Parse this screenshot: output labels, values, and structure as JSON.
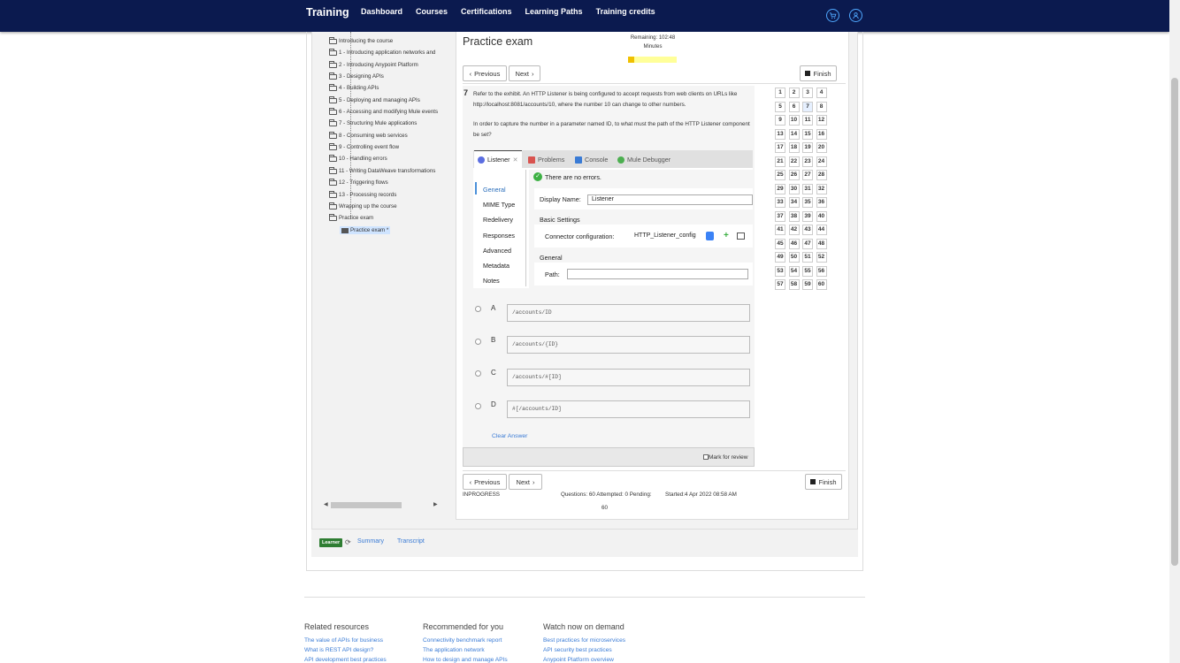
{
  "nav": {
    "brand": "Training",
    "links": [
      "Dashboard",
      "Courses",
      "Certifications",
      "Learning Paths",
      "Training credits"
    ]
  },
  "tree": {
    "items": [
      {
        "label": "Introducing the course"
      },
      {
        "label": "1 - Introducing application networks and"
      },
      {
        "label": "2 - Introducing Anypoint Platform"
      },
      {
        "label": "3 - Designing APIs"
      },
      {
        "label": "4 - Building APIs"
      },
      {
        "label": "5 - Deploying and managing APIs"
      },
      {
        "label": "6 - Accessing and modifying Mule events"
      },
      {
        "label": "7 - Structuring Mule applications"
      },
      {
        "label": "8 - Consuming web services"
      },
      {
        "label": "9 - Controlling event flow"
      },
      {
        "label": "10 - Handling errors"
      },
      {
        "label": "11 - Writing DataWeave transformations"
      },
      {
        "label": "12 - Triggering flows"
      },
      {
        "label": "13 - Processing records"
      },
      {
        "label": "Wrapping up the course"
      },
      {
        "label": "Practice exam"
      }
    ],
    "selected_child": "Practice exam *"
  },
  "exam": {
    "title": "Practice exam",
    "remaining_label": "Remaining: 102:48",
    "remaining_unit": "Minutes",
    "time_used_fraction": 0.13,
    "prev_label": "Previous",
    "next_label": "Next",
    "finish_label": "Finish",
    "question_number": "7",
    "question_text_1": "Refer to the exhibit. An HTTP Listener is being configured to accept requests from web clients on URLs like http://localhost:8081/accounts/10, where the number 10 can change to other numbers.",
    "question_text_2": "In order to capture the number in a parameter named ID, to what must the path of the HTTP Listener component be set?",
    "exhibit": {
      "tabs": [
        "Listener",
        "Problems",
        "Console",
        "Mule Debugger"
      ],
      "status": "There are no errors.",
      "sidebar": [
        "General",
        "MIME Type",
        "Redelivery",
        "Responses",
        "Advanced",
        "Metadata",
        "Notes"
      ],
      "display_name_label": "Display Name:",
      "display_name_value": "Listener",
      "basic_settings": "Basic Settings",
      "connector_label": "Connector configuration:",
      "connector_value": "HTTP_Listener_config",
      "general_section": "General",
      "path_label": "Path:"
    },
    "options": [
      {
        "letter": "A",
        "value": "/accounts/ID"
      },
      {
        "letter": "B",
        "value": "/accounts/{ID}"
      },
      {
        "letter": "C",
        "value": "/accounts/#[ID]"
      },
      {
        "letter": "D",
        "value": "#[/accounts/ID]"
      }
    ],
    "clear_answer": "Clear Answer",
    "mark_review": "Mark for review",
    "question_grid": [
      "1",
      "2",
      "3",
      "4",
      "5",
      "6",
      "7",
      "8",
      "9",
      "10",
      "11",
      "12",
      "13",
      "14",
      "15",
      "16",
      "17",
      "18",
      "19",
      "20",
      "21",
      "22",
      "23",
      "24",
      "25",
      "26",
      "27",
      "28",
      "29",
      "30",
      "31",
      "32",
      "33",
      "34",
      "35",
      "36",
      "37",
      "38",
      "39",
      "40",
      "41",
      "42",
      "43",
      "44",
      "45",
      "46",
      "47",
      "48",
      "49",
      "50",
      "51",
      "52",
      "53",
      "54",
      "55",
      "56",
      "57",
      "58",
      "59",
      "60"
    ],
    "current_question": "7",
    "status": "INPROGRESS",
    "questions_info": "Questions: 60 Attempted: 0 Pending:",
    "pending_count": "60",
    "started": "Started:4 Apr 2022 08:58 AM"
  },
  "learner": {
    "badge": "Learner",
    "summary": "Summary",
    "transcript": "Transcript"
  },
  "footer": {
    "columns": [
      {
        "heading": "Related resources",
        "links": [
          "The value of APIs for business",
          "What is REST API design?",
          "API development best practices"
        ]
      },
      {
        "heading": "Recommended for you",
        "links": [
          "Connectivity benchmark report",
          "The application network",
          "How to design and manage APIs"
        ]
      },
      {
        "heading": "Watch now on demand",
        "links": [
          "Best practices for microservices",
          "API security best practices",
          "Anypoint Platform overview"
        ]
      }
    ]
  }
}
